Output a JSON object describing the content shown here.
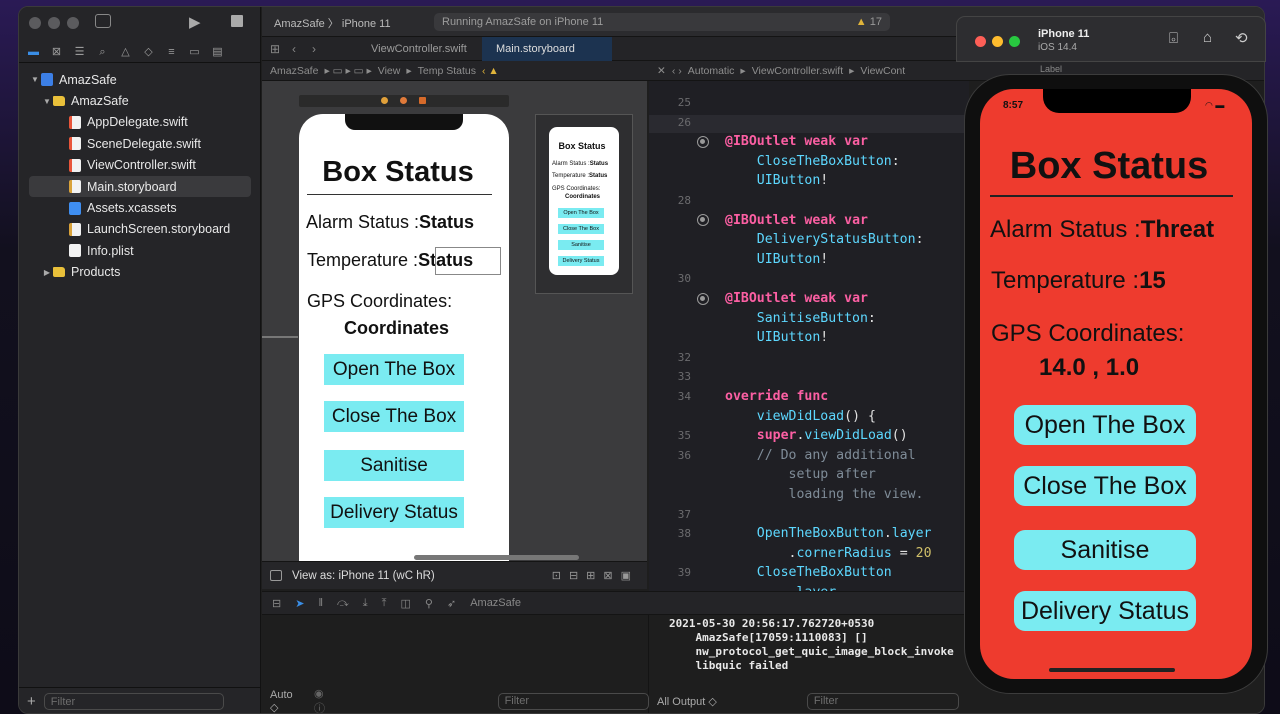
{
  "xcode": {
    "scheme": "AmazSafe",
    "device": "iPhone 11",
    "status": "Running AmazSafe on iPhone 11",
    "warnings": "17",
    "tabs": [
      "ViewController.swift",
      "Main.storyboard"
    ],
    "navigator": {
      "project": "AmazSafe",
      "group": "AmazSafe",
      "files": [
        "AppDelegate.swift",
        "SceneDelegate.swift",
        "ViewController.swift",
        "Main.storyboard",
        "Assets.xcassets",
        "LaunchScreen.storyboard",
        "Info.plist"
      ],
      "products": "Products",
      "filter_placeholder": "Filter"
    },
    "ib_jump": [
      "AmazSafe",
      "View",
      "Temp Status"
    ],
    "editor_jump": [
      "Automatic",
      "ViewController.swift",
      "ViewCont"
    ],
    "view_as": "View as: iPhone 11 (wC hR)",
    "debug_scheme": "AmazSafe",
    "auto_label": "Auto ◇",
    "all_output": "All Output ◇",
    "filter": "Filter"
  },
  "storyboard": {
    "title": "Box Status",
    "alarm_label": "Alarm Status :",
    "alarm_value": "Status",
    "temp_label": "Temperature :",
    "temp_value": "Status",
    "gps_label": "GPS  Coordinates:",
    "gps_value": "Coordinates",
    "buttons": [
      "Open The Box",
      "Close The Box",
      "Sanitise",
      "Delivery Status"
    ]
  },
  "code": {
    "lines": [
      {
        "n": "25",
        "text": ""
      },
      {
        "n": "26",
        "text": ""
      },
      {
        "n": "",
        "text": "@IBOutlet weak var"
      },
      {
        "n": "",
        "text": "    CloseTheBoxButton:"
      },
      {
        "n": "",
        "text": "    UIButton!"
      },
      {
        "n": "28",
        "text": ""
      },
      {
        "n": "",
        "text": "@IBOutlet weak var"
      },
      {
        "n": "",
        "text": "    DeliveryStatusButton:"
      },
      {
        "n": "",
        "text": "    UIButton!"
      },
      {
        "n": "30",
        "text": ""
      },
      {
        "n": "",
        "text": "@IBOutlet weak var"
      },
      {
        "n": "",
        "text": "    SanitiseButton:"
      },
      {
        "n": "",
        "text": "    UIButton!"
      },
      {
        "n": "32",
        "text": ""
      },
      {
        "n": "33",
        "text": ""
      },
      {
        "n": "34",
        "text": "override func"
      },
      {
        "n": "",
        "text": "    viewDidLoad() {"
      },
      {
        "n": "35",
        "text": "    super.viewDidLoad()"
      },
      {
        "n": "36",
        "text": "    // Do any additional"
      },
      {
        "n": "",
        "text": "        setup after"
      },
      {
        "n": "",
        "text": "        loading the view."
      },
      {
        "n": "37",
        "text": ""
      },
      {
        "n": "38",
        "text": "    OpenTheBoxButton.layer"
      },
      {
        "n": "",
        "text": "        .cornerRadius = 20"
      },
      {
        "n": "39",
        "text": "    CloseTheBoxButton"
      },
      {
        "n": "",
        "text": "        .layer"
      }
    ]
  },
  "console": {
    "line1": "2021-05-30 20:56:17.762720+0530",
    "line2": "    AmazSafe[17059:1110083] []",
    "line3": "    nw_protocol_get_quic_image_block_invoke",
    "line4": "    libquic failed"
  },
  "simulator": {
    "device": "iPhone 11",
    "os": "iOS 14.4",
    "time": "8:57",
    "label_hint": "Label",
    "title": "Box Status",
    "alarm_label": "Alarm Status :",
    "alarm_value": "Threat",
    "temp_label": "Temperature :",
    "temp_value": "15",
    "gps_label": "GPS  Coordinates:",
    "gps_value": "14.0 , 1.0",
    "buttons": [
      "Open The Box",
      "Close The Box",
      "Sanitise",
      "Delivery Status"
    ],
    "background": "#ee3b2e",
    "button_color": "#7aebf1"
  }
}
